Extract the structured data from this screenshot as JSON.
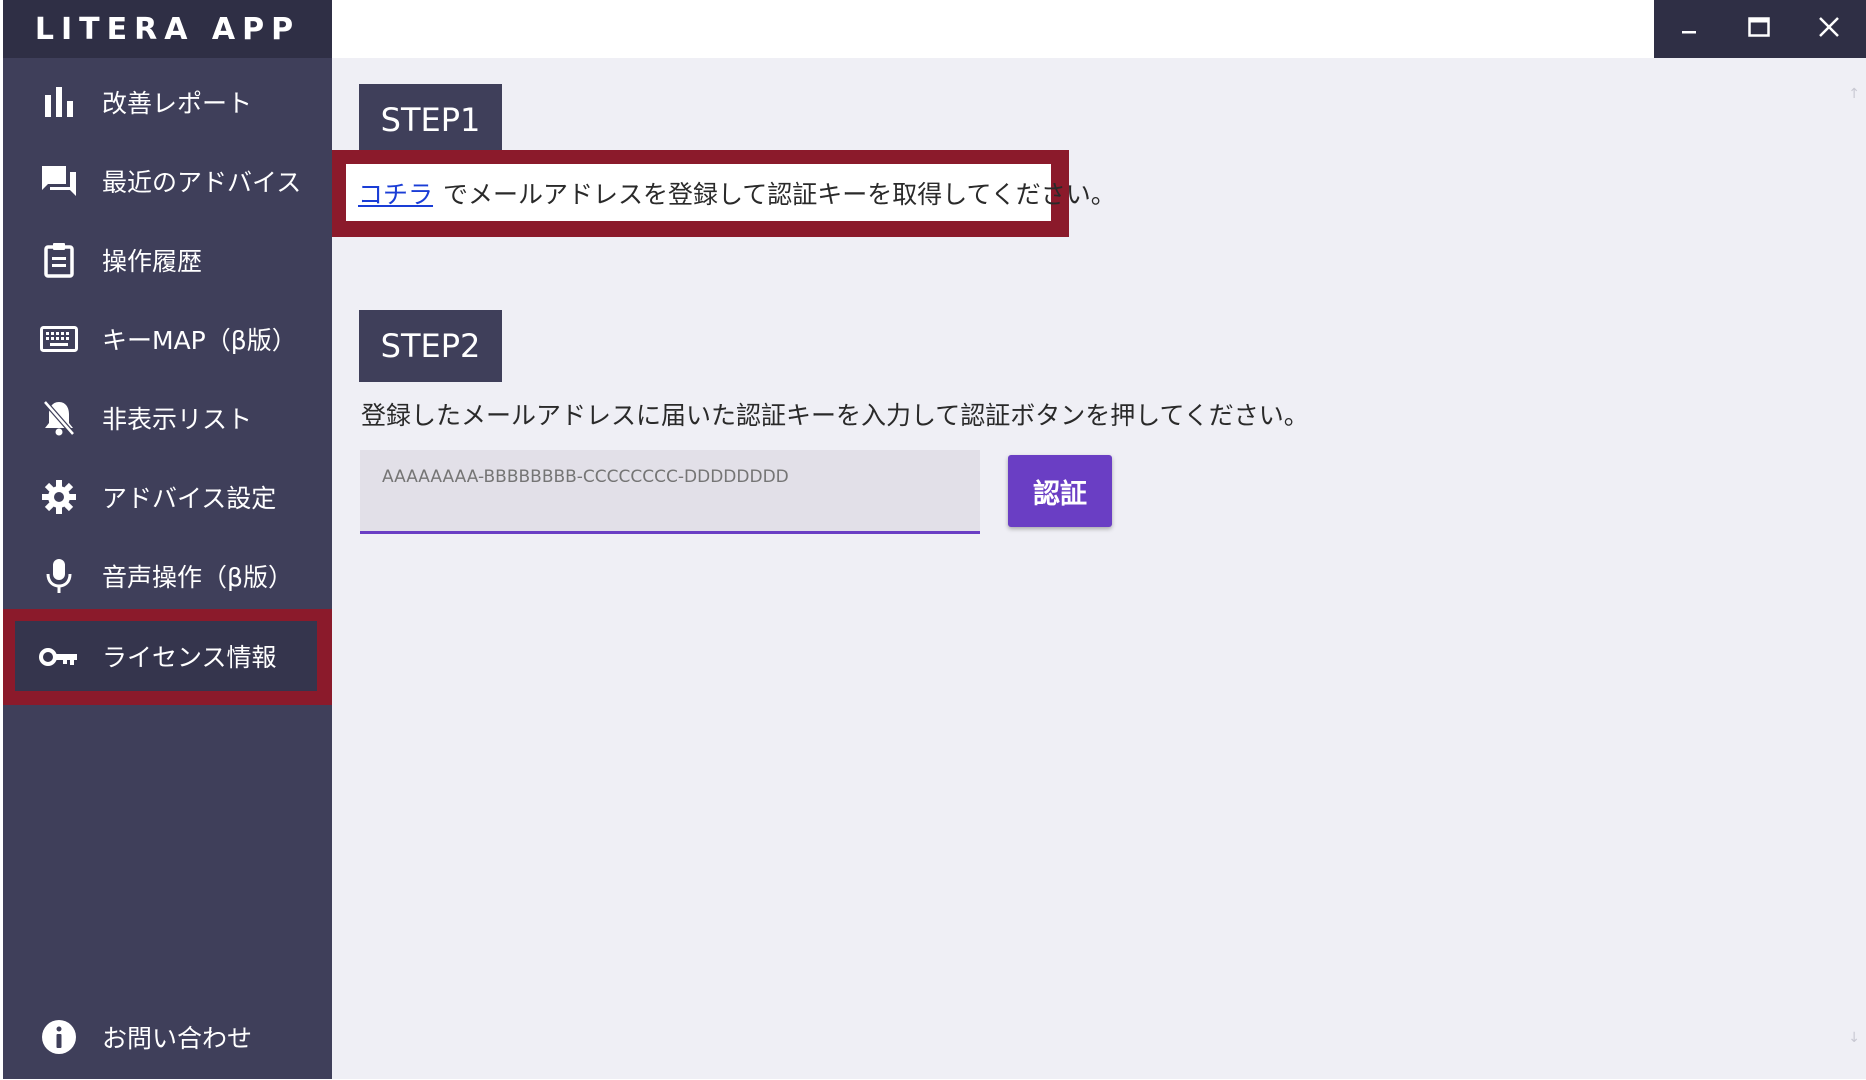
{
  "app": {
    "title": "LITERA APP"
  },
  "sidebar": {
    "items": [
      {
        "label": "改善レポート",
        "icon": "bar-chart-icon"
      },
      {
        "label": "最近のアドバイス",
        "icon": "chat-icon"
      },
      {
        "label": "操作履歴",
        "icon": "clipboard-icon"
      },
      {
        "label": "キーMAP（β版）",
        "icon": "keyboard-icon"
      },
      {
        "label": "非表示リスト",
        "icon": "bell-off-icon"
      },
      {
        "label": "アドバイス設定",
        "icon": "gear-icon"
      },
      {
        "label": "音声操作（β版）",
        "icon": "microphone-icon"
      },
      {
        "label": "ライセンス情報",
        "icon": "key-icon",
        "active": true
      }
    ],
    "footer": {
      "label": "お問い合わせ",
      "icon": "info-icon"
    }
  },
  "window_controls": {
    "minimize": "minimize-icon",
    "maximize": "maximize-icon",
    "close": "close-icon"
  },
  "main": {
    "step1": {
      "header": "STEP1",
      "link_text": "コチラ",
      "text": "でメールアドレスを登録して認証キーを取得してください。"
    },
    "step2": {
      "header": "STEP2",
      "text": "登録したメールアドレスに届いた認証キーを入力して認証ボタンを押してください。",
      "key_placeholder": "AAAAAAAA-BBBBBBBB-CCCCCCCC-DDDDDDDD",
      "button_label": "認証"
    }
  },
  "colors": {
    "sidebar_bg": "#3f3f5a",
    "title_bg": "#2f2f45",
    "highlight": "#8b1a2b",
    "accent": "#6a3ec4",
    "main_bg": "#efeff5",
    "link": "#1a3dd6"
  }
}
